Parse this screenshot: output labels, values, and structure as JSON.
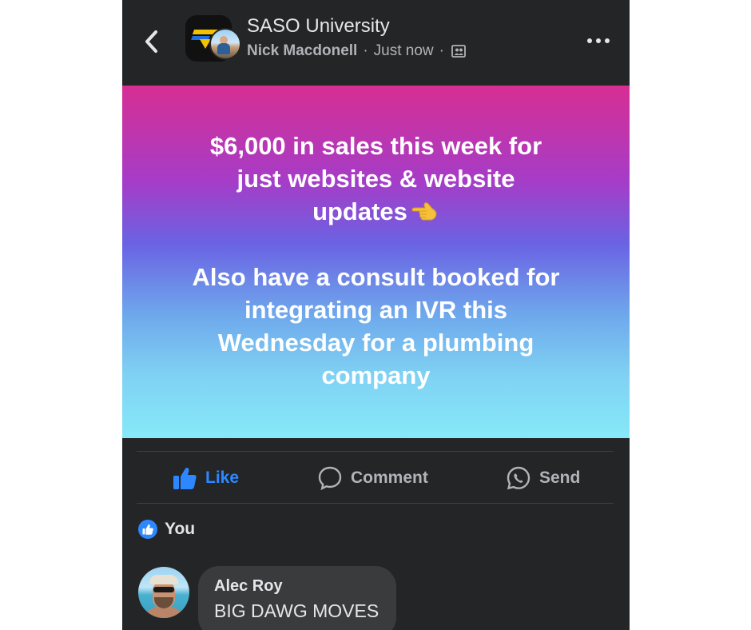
{
  "header": {
    "group_name": "SASO University",
    "author": "Nick Macdonell",
    "separator": "·",
    "timestamp": "Just now",
    "privacy_icon": "group-privacy-icon"
  },
  "post": {
    "line1": "$6,000 in sales this week for\njust websites & website\nupdates",
    "emoji": "backhand-index-pointing-left-emoji",
    "line2": "Also have a consult booked for\nintegrating an IVR this\nWednesday for a plumbing\ncompany",
    "background_gradient": [
      "#d72e93",
      "#a63cc7",
      "#6a63e3",
      "#6ea8ec",
      "#86e9f8"
    ]
  },
  "actions": {
    "like_label": "Like",
    "comment_label": "Comment",
    "send_label": "Send",
    "like_active_color": "#2d88ff"
  },
  "reactions": {
    "reactor": "You",
    "reaction_type": "like"
  },
  "comment": {
    "author": "Alec Roy",
    "text": "BIG DAWG MOVES"
  },
  "colors": {
    "surface": "#242526",
    "bubble": "#3a3b3c",
    "primary_text": "#e4e6eb",
    "secondary_text": "#b0b3b8",
    "accent": "#2d88ff"
  }
}
